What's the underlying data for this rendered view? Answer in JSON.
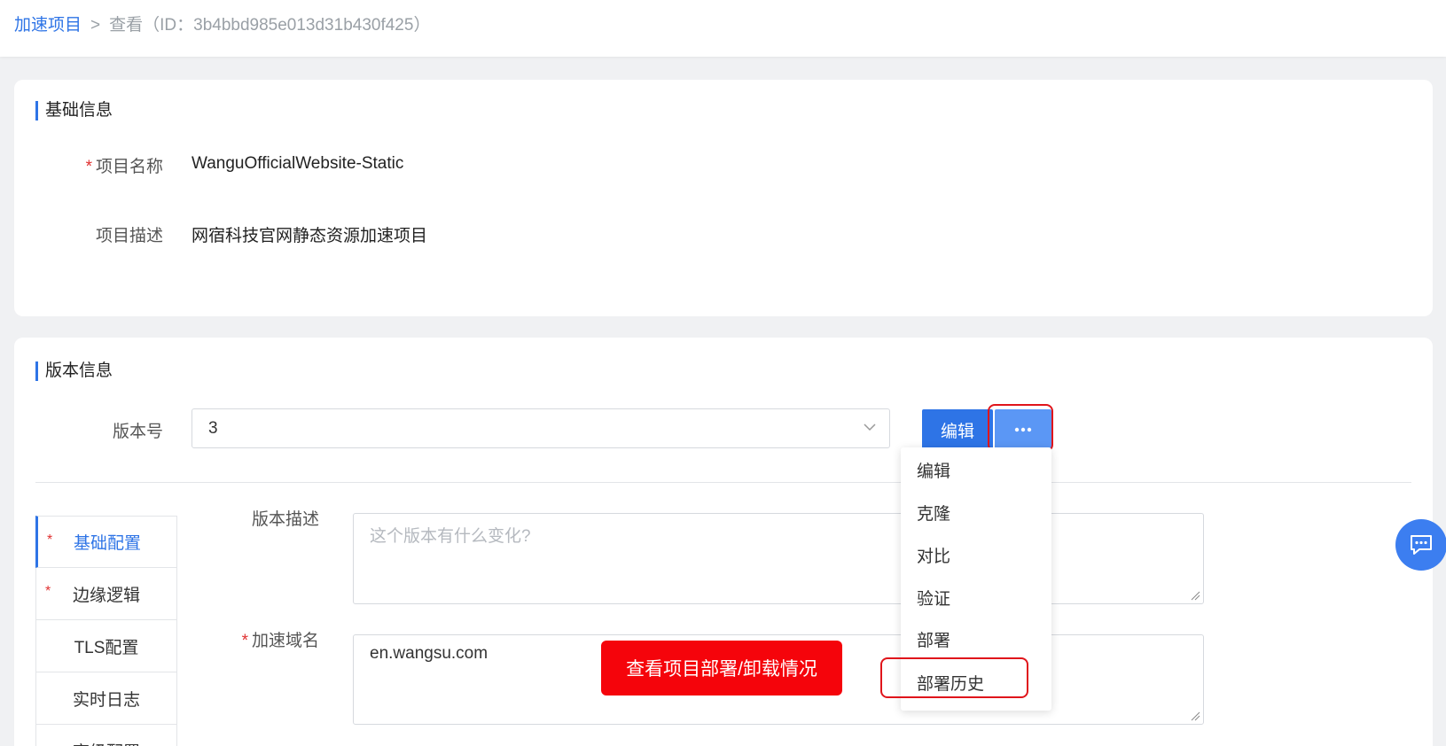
{
  "breadcrumb": {
    "root": "加速项目",
    "separator": ">",
    "current": "查看（ID：3b4bbd985e013d31b430f425）"
  },
  "basic_info": {
    "section_title": "基础信息",
    "project_name_label": "项目名称",
    "project_name_value": "WanguOfficialWebsite-Static",
    "project_desc_label": "项目描述",
    "project_desc_value": "网宿科技官网静态资源加速项目"
  },
  "version_info": {
    "section_title": "版本信息",
    "version_label": "版本号",
    "version_value": "3",
    "edit_button": "编辑",
    "more_button_icon": "more-dots-icon"
  },
  "side_nav": {
    "items": [
      {
        "label": "基础配置",
        "required": true,
        "active": true
      },
      {
        "label": "边缘逻辑",
        "required": true,
        "active": false
      },
      {
        "label": "TLS配置",
        "required": false,
        "active": false
      },
      {
        "label": "实时日志",
        "required": false,
        "active": false
      },
      {
        "label": "高级配置",
        "required": false,
        "active": false
      }
    ]
  },
  "form": {
    "version_desc_label": "版本描述",
    "version_desc_placeholder": "这个版本有什么变化?",
    "domain_label": "加速域名",
    "domain_value": "en.wangsu.com"
  },
  "dropdown": {
    "items": [
      "编辑",
      "克隆",
      "对比",
      "验证",
      "部署",
      "部署历史"
    ]
  },
  "tooltip": {
    "text": "查看项目部署/卸载情况"
  },
  "colors": {
    "primary": "#2e74e6",
    "highlight": "#e0151b",
    "tooltip_bg": "#f5040b"
  }
}
